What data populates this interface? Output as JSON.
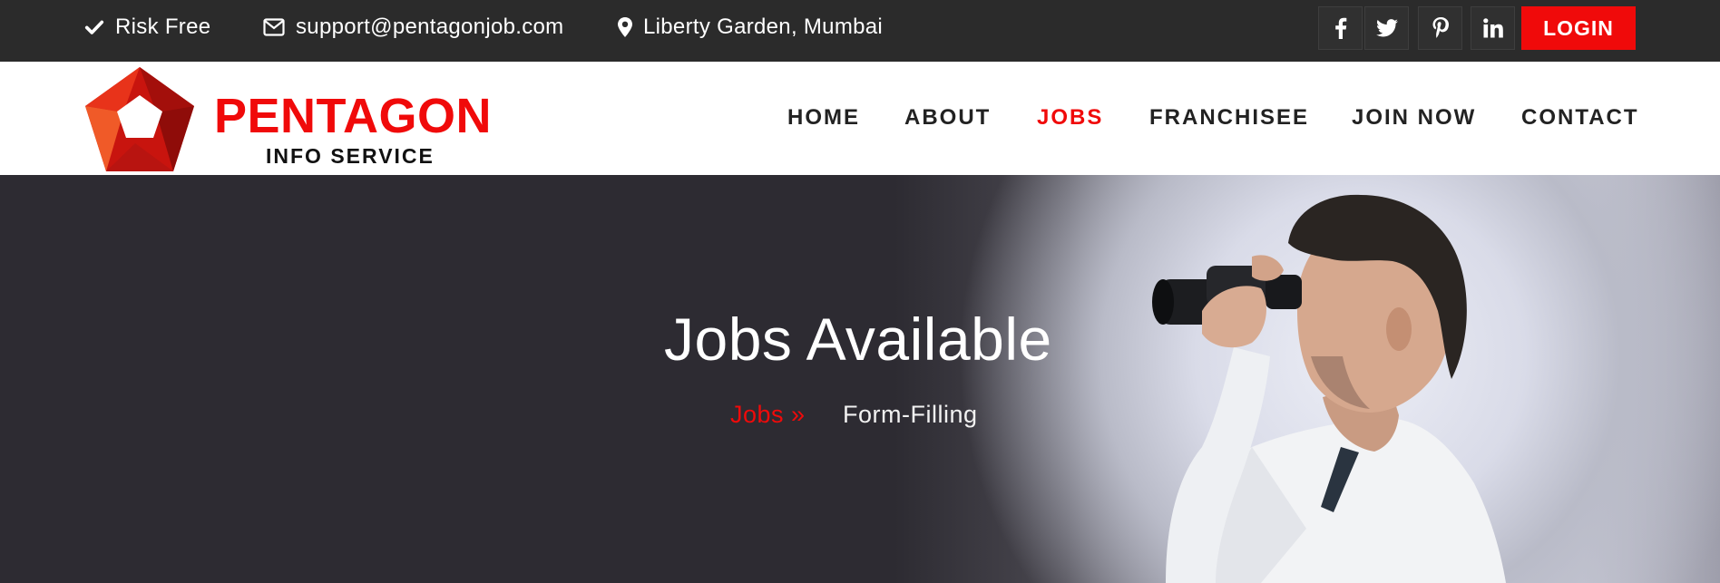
{
  "topbar": {
    "risk_free": "Risk Free",
    "email": "support@pentagonjob.com",
    "location": "Liberty Garden, Mumbai",
    "social": [
      "facebook-icon",
      "twitter-icon",
      "pinterest-icon",
      "linkedin-icon"
    ],
    "login_label": "LOGIN"
  },
  "logo": {
    "title": "PENTAGON",
    "subtitle": "INFO SERVICE"
  },
  "nav": {
    "items": [
      {
        "label": "HOME"
      },
      {
        "label": "ABOUT"
      },
      {
        "label": "JOBS"
      },
      {
        "label": "FRANCHISEE"
      },
      {
        "label": "JOIN NOW"
      },
      {
        "label": "CONTACT"
      }
    ],
    "active": "JOBS"
  },
  "hero": {
    "title": "Jobs Available",
    "breadcrumb_link": "Jobs »",
    "breadcrumb_current": "Form-Filling"
  },
  "colors": {
    "brand_red": "#f00a0a",
    "topbar_bg": "#2b2b2b",
    "hero_dark": "#2d2b32"
  }
}
